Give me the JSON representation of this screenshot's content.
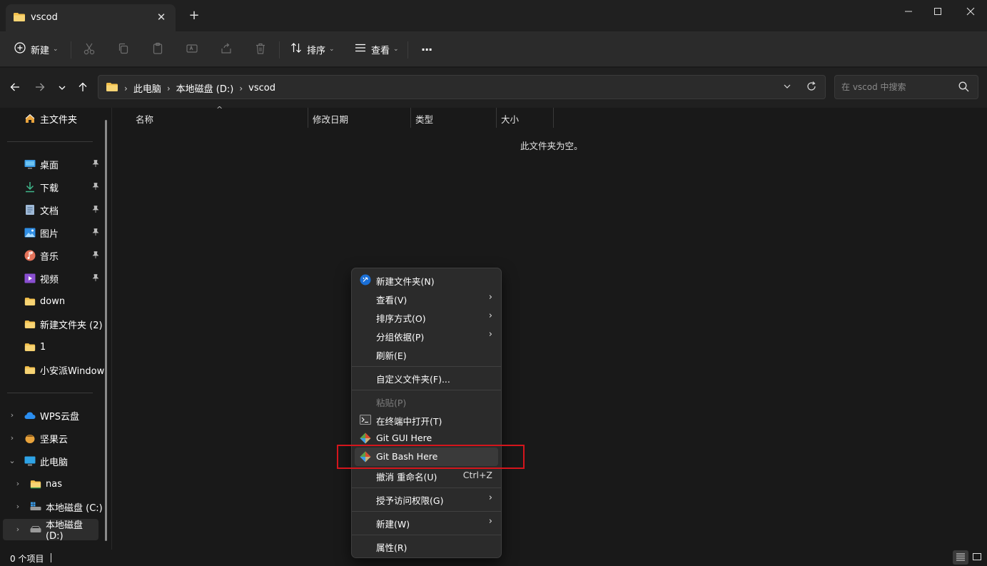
{
  "window": {
    "tab_title": "vscod",
    "tab_close": "✕",
    "new_tab": "+",
    "minimize": "—",
    "maximize": "☐",
    "close": "✕"
  },
  "toolbar": {
    "new_label": "新建",
    "sort_label": "排序",
    "view_label": "查看",
    "more_label": "···",
    "icons": [
      "cut-icon",
      "copy-icon",
      "paste-icon",
      "rename-icon",
      "share-icon",
      "delete-icon"
    ]
  },
  "address": {
    "crumbs": [
      "此电脑",
      "本地磁盘 (D:)",
      "vscod"
    ],
    "search_placeholder": "在 vscod 中搜索"
  },
  "sidebar": {
    "home": "主文件夹",
    "pinned": [
      {
        "label": "桌面",
        "icon": "desktop-icon"
      },
      {
        "label": "下载",
        "icon": "download-icon"
      },
      {
        "label": "文档",
        "icon": "documents-icon"
      },
      {
        "label": "图片",
        "icon": "pictures-icon"
      },
      {
        "label": "音乐",
        "icon": "music-icon"
      },
      {
        "label": "视频",
        "icon": "videos-icon"
      }
    ],
    "folders": [
      "down",
      "新建文件夹 (2)",
      "1",
      "小安派Window"
    ],
    "locations": [
      {
        "label": "WPS云盘",
        "icon": "cloud-icon"
      },
      {
        "label": "坚果云",
        "icon": "nut-cloud-icon"
      },
      {
        "label": "此电脑",
        "icon": "this-pc-icon"
      },
      {
        "label": "nas",
        "icon": "folder-icon"
      },
      {
        "label": "本地磁盘 (C:)",
        "icon": "drive-c-icon"
      },
      {
        "label": "本地磁盘 (D:)",
        "icon": "drive-d-icon"
      }
    ]
  },
  "content": {
    "columns": [
      "名称",
      "修改日期",
      "类型",
      "大小"
    ],
    "sort_indicator": "^",
    "empty_message": "此文件夹为空。"
  },
  "status": {
    "item_count": "0 个项目"
  },
  "context_menu": {
    "items": [
      {
        "label": "新建文件夹(N)",
        "icon": "new-folder-icon"
      },
      {
        "label": "查看(V)",
        "arrow": "›"
      },
      {
        "label": "排序方式(O)",
        "arrow": "›"
      },
      {
        "label": "分组依据(P)",
        "arrow": "›"
      },
      {
        "label": "刷新(E)"
      },
      {
        "label": "自定义文件夹(F)..."
      },
      {
        "label": "粘贴(P)",
        "disabled": true
      },
      {
        "label": "在终端中打开(T)",
        "icon": "terminal-icon"
      },
      {
        "label": "Git GUI Here",
        "icon": "git-icon"
      },
      {
        "label": "Git Bash Here",
        "icon": "git-icon"
      },
      {
        "label": "撤消 重命名(U)",
        "shortcut": "Ctrl+Z"
      },
      {
        "label": "授予访问权限(G)",
        "arrow": "›"
      },
      {
        "label": "新建(W)",
        "arrow": "›"
      },
      {
        "label": "属性(R)"
      }
    ]
  },
  "colors": {
    "accent_blue": "#1a6fd6",
    "folder_yellow": "#f3c04b",
    "highlight_red": "#d5151c"
  }
}
